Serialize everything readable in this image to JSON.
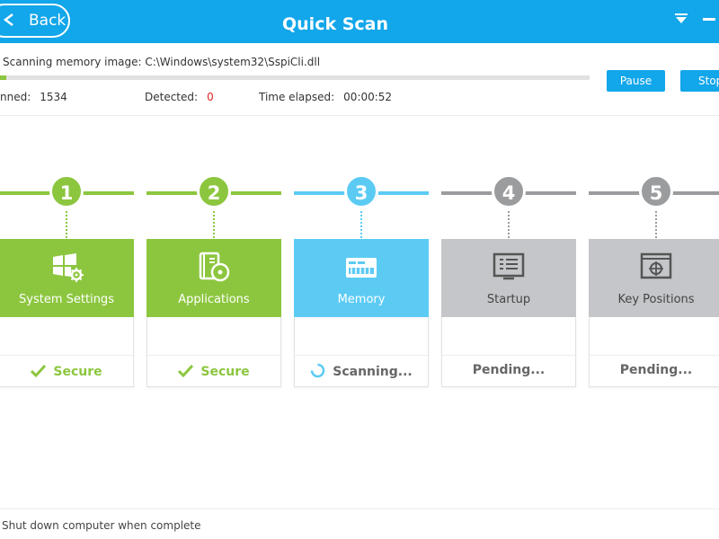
{
  "header": {
    "back_label": "Back",
    "title": "Quick Scan"
  },
  "scan": {
    "status_text": "Scanning memory image: C:\\Windows\\system32\\SspiCli.dll",
    "progress": 0.01,
    "scanned_label": "nned:",
    "scanned_value": "1534",
    "detected_label": "Detected:",
    "detected_value": "0",
    "elapsed_label": "Time elapsed:",
    "elapsed_value": "00:00:52",
    "pause_label": "Pause",
    "stop_label": "Stop"
  },
  "steps": [
    {
      "number": "1",
      "label": "System Settings",
      "status": "Secure",
      "state": "done",
      "icon": "windows-gear-icon"
    },
    {
      "number": "2",
      "label": "Applications",
      "status": "Secure",
      "state": "done",
      "icon": "applications-icon"
    },
    {
      "number": "3",
      "label": "Memory",
      "status": "Scanning...",
      "state": "active",
      "icon": "memory-icon"
    },
    {
      "number": "4",
      "label": "Startup",
      "status": "Pending...",
      "state": "pending",
      "icon": "startup-icon"
    },
    {
      "number": "5",
      "label": "Key Positions",
      "status": "Pending...",
      "state": "pending",
      "icon": "key-positions-icon"
    }
  ],
  "footer": {
    "shutdown_label": "Shut down computer when complete"
  },
  "colors": {
    "header": "#12a6ea",
    "done": "#8cc63f",
    "active": "#5ccbf4",
    "pending": "#c4c6c9",
    "pending_dark": "#9b9c9e",
    "detected": "#e02424"
  }
}
